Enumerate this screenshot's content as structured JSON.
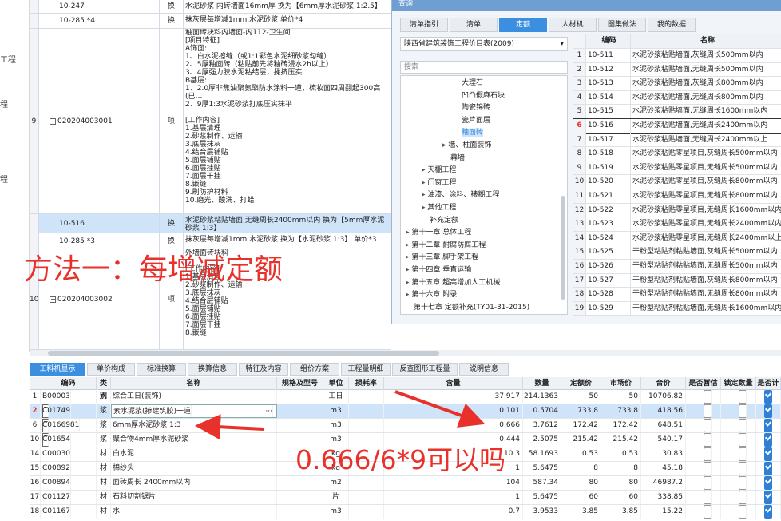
{
  "left_strip": [
    "工程",
    "程",
    "程"
  ],
  "grid_rows": [
    {
      "seq": "",
      "code": "10-247",
      "cat": "换",
      "name": "水泥砂浆 内砖墙面16mm厚  换为【6mm厚水泥砂浆 1:2.5】",
      "indent": true
    },
    {
      "seq": "",
      "code": "10-285 *4",
      "cat": "换",
      "name": "抹灰层每增减1mm,水泥砂浆  单价*4",
      "indent": true
    },
    {
      "seq": "9",
      "code": "020204003001",
      "cat": "项",
      "name": "釉面砖块料内墙面-内112-卫生间\n[项目特征]\nA饰面:\n1、白水泥擦缝（或1:1彩色水泥细砂浆勾缝）\n2、5厚釉面砖（粘贴前先将釉砖浸水2h以上）\n3、4厚强力胶水泥粘结层，揉挤压实\nB基层:\n1、2.0厚非焦油聚氨酯防水涂料一道，梳妆面四周翻起300高(已…\n2、9厚1:3水泥砂浆打底压实抹平\n\n[工作内容]\n1.基层清理\n2.砂浆制作、运输\n3.底层抹灰\n4.结合层铺贴\n5.面层铺贴\n6.面层挂贴\n7.面层干挂\n8.嵌缝\n9.刷防护材料\n10.磨光、酸洗、打蜡",
      "indent": false
    },
    {
      "seq": "",
      "code": "10-516",
      "cat": "换",
      "name": "水泥砂浆粘贴墙面,无缝周长2400mm以内  换为【5mm厚水泥砂浆 1:3】",
      "indent": true
    },
    {
      "seq": "",
      "code": "10-285 *3",
      "cat": "换",
      "name": "抹灰层每增减1mm,水泥砂浆  换为【水泥砂浆 1:3】  单价*3",
      "indent": true
    },
    {
      "seq": "10",
      "code": "020204003002",
      "cat": "项",
      "name": "外墙面砖块料\n\n[工作内容]\n1.基层清理\n2.砂浆制作、运输\n3.底层抹灰\n4.结合层铺贴\n5.面层铺贴\n6.面层挂贴\n7.面层干挂\n8.嵌缝",
      "indent": false
    }
  ],
  "annotation_1": "方法一：每增减定额",
  "annotation_2": "0.666/6*9可以吗",
  "dialog": {
    "title": "查询",
    "tabs": [
      "清单指引",
      "清单",
      "定额",
      "人材机",
      "图集做法",
      "我的数据"
    ],
    "active_tab": "定额",
    "quota_select": "陕西省建筑装饰工程价目表(2009)",
    "search_placeholder": "搜索",
    "tree": [
      {
        "label": "大理石",
        "level": 3
      },
      {
        "label": "凹凸假麻石块",
        "level": 3
      },
      {
        "label": "陶瓷锦砖",
        "level": 3
      },
      {
        "label": "瓷片面层",
        "level": 3
      },
      {
        "label": "釉面砖",
        "level": 3,
        "selected": true
      },
      {
        "label": "墙、柱面装饰",
        "level": 2,
        "arrow": "▸"
      },
      {
        "label": "幕墙",
        "level": 2
      },
      {
        "label": "天棚工程",
        "level": 1,
        "arrow": "▸"
      },
      {
        "label": "门窗工程",
        "level": 1,
        "arrow": "▸"
      },
      {
        "label": "油漆、涂料、裱糊工程",
        "level": 1,
        "arrow": "▸"
      },
      {
        "label": "其他工程",
        "level": 1,
        "arrow": "▸"
      },
      {
        "label": "补充定额",
        "level": 1
      },
      {
        "label": "第十一章 总体工程",
        "level": 0,
        "arrow": "▸"
      },
      {
        "label": "第十二章 耐腐防腐工程",
        "level": 0,
        "arrow": "▸"
      },
      {
        "label": "第十三章 脚手架工程",
        "level": 0,
        "arrow": "▸"
      },
      {
        "label": "第十四章 垂直运输",
        "level": 0,
        "arrow": "▸"
      },
      {
        "label": "第十五章 超高增加人工机械",
        "level": 0,
        "arrow": "▸"
      },
      {
        "label": "第十六章 附录",
        "level": 0,
        "arrow": "▸"
      },
      {
        "label": "第十七章 定额补充(TY01-31-2015)",
        "level": 0
      }
    ],
    "table_head": {
      "code": "编码",
      "name": "名称"
    },
    "table_rows": [
      {
        "n": "1",
        "code": "10-511",
        "name": "水泥砂浆粘贴墙面,灰缝周长500mm以内"
      },
      {
        "n": "2",
        "code": "10-512",
        "name": "水泥砂浆粘贴墙面,无缝周长500mm以内"
      },
      {
        "n": "3",
        "code": "10-513",
        "name": "水泥砂浆粘贴墙面,灰缝周长800mm以内"
      },
      {
        "n": "4",
        "code": "10-514",
        "name": "水泥砂浆粘贴墙面,无缝周长800mm以内"
      },
      {
        "n": "5",
        "code": "10-515",
        "name": "水泥砂浆粘贴墙面,无缝周长1600mm以内"
      },
      {
        "n": "6",
        "code": "10-516",
        "name": "水泥砂浆粘贴墙面,无缝周长2400mm以内",
        "selected": true
      },
      {
        "n": "7",
        "code": "10-517",
        "name": "水泥砂浆粘贴墙面,无缝周长2400mm以上"
      },
      {
        "n": "8",
        "code": "10-518",
        "name": "水泥砂浆粘贴零星项目,灰缝周长500mm以内"
      },
      {
        "n": "9",
        "code": "10-519",
        "name": "水泥砂浆粘贴零星项目,无缝周长500mm以内"
      },
      {
        "n": "10",
        "code": "10-520",
        "name": "水泥砂浆粘贴零星项目,灰缝周长800mm以内"
      },
      {
        "n": "11",
        "code": "10-521",
        "name": "水泥砂浆粘贴零星项目,无缝周长800mm以内"
      },
      {
        "n": "12",
        "code": "10-522",
        "name": "水泥砂浆粘贴零星项目,无缝周长1600mm以内"
      },
      {
        "n": "13",
        "code": "10-523",
        "name": "水泥砂浆粘贴零星项目,无缝周长2400mm以内"
      },
      {
        "n": "14",
        "code": "10-524",
        "name": "水泥砂浆粘贴零星项目,无缝周长2400mm以上"
      },
      {
        "n": "15",
        "code": "10-525",
        "name": "干粉型粘贴剂粘贴墙面,灰缝周长500mm以内"
      },
      {
        "n": "16",
        "code": "10-526",
        "name": "干粉型粘贴剂粘贴墙面,无缝周长500mm以内"
      },
      {
        "n": "17",
        "code": "10-527",
        "name": "干粉型粘贴剂粘贴墙面,灰缝周长800mm以内"
      },
      {
        "n": "18",
        "code": "10-528",
        "name": "干粉型粘贴剂粘贴墙面,无缝周长800mm以内"
      },
      {
        "n": "19",
        "code": "10-529",
        "name": "干粉型粘贴剂粘贴墙面,无缝周长1600mm以内"
      }
    ]
  },
  "bottom_tabs": [
    "工料机显示",
    "单价构成",
    "标准换算",
    "换算信息",
    "特征及内容",
    "组价方案",
    "工程量明细",
    "反查图形工程量",
    "说明信息"
  ],
  "bottom_active": "工料机显示",
  "materials_head": [
    "编码",
    "类别",
    "名称",
    "规格及型号",
    "单位",
    "损耗率",
    "含量",
    "数量",
    "定额价",
    "市场价",
    "合价",
    "是否暂估",
    "锁定数量",
    "是否计"
  ],
  "materials": [
    {
      "n": "1",
      "code": "B00003",
      "cat": "人",
      "name": "综合工日(装饰)",
      "spec": "",
      "unit": "工日",
      "loss": "",
      "content": "37.917",
      "qty": "214.1363",
      "quota": "50",
      "market": "50",
      "total": "10706.82",
      "est": false,
      "lock": false,
      "calc": true,
      "plus": false
    },
    {
      "n": "2",
      "code": "C01749",
      "cat": "浆",
      "name": "素水泥浆(掺建筑胶)一道",
      "spec": "",
      "unit": "m3",
      "loss": "",
      "content": "0.101",
      "qty": "0.5704",
      "quota": "733.8",
      "market": "733.8",
      "total": "418.56",
      "est": false,
      "lock": false,
      "calc": true,
      "plus": true,
      "selected": true
    },
    {
      "n": "6",
      "code": "C0166981",
      "cat": "浆",
      "name": "6mm厚水泥砂浆 1:3",
      "spec": "",
      "unit": "m3",
      "loss": "",
      "content": "0.666",
      "qty": "3.7612",
      "quota": "172.42",
      "market": "172.42",
      "total": "648.51",
      "est": false,
      "lock": false,
      "calc": true,
      "plus": true
    },
    {
      "n": "10",
      "code": "C01654",
      "cat": "浆",
      "name": "聚合物4mm厚水泥砂浆",
      "spec": "",
      "unit": "m3",
      "loss": "",
      "content": "0.444",
      "qty": "2.5075",
      "quota": "215.42",
      "market": "215.42",
      "total": "540.17",
      "est": false,
      "lock": false,
      "calc": true,
      "plus": true
    },
    {
      "n": "14",
      "code": "C00030",
      "cat": "材",
      "name": "白水泥",
      "spec": "",
      "unit": "kg",
      "loss": "",
      "content": "10.3",
      "qty": "58.1693",
      "quota": "0.53",
      "market": "0.53",
      "total": "30.83",
      "est": false,
      "lock": false,
      "calc": true,
      "plus": false
    },
    {
      "n": "15",
      "code": "C00892",
      "cat": "材",
      "name": "棉纱头",
      "spec": "",
      "unit": "kg",
      "loss": "",
      "content": "1",
      "qty": "5.6475",
      "quota": "8",
      "market": "8",
      "total": "45.18",
      "est": false,
      "lock": false,
      "calc": true,
      "plus": false
    },
    {
      "n": "16",
      "code": "C00894",
      "cat": "材",
      "name": "面砖周长 2400mm以内",
      "spec": "",
      "unit": "m2",
      "loss": "",
      "content": "104",
      "qty": "587.34",
      "quota": "80",
      "market": "80",
      "total": "46987.2",
      "est": false,
      "lock": false,
      "calc": true,
      "plus": false
    },
    {
      "n": "17",
      "code": "C01127",
      "cat": "材",
      "name": "石料切割锯片",
      "spec": "",
      "unit": "片",
      "loss": "",
      "content": "1",
      "qty": "5.6475",
      "quota": "60",
      "market": "60",
      "total": "338.85",
      "est": false,
      "lock": false,
      "calc": true,
      "plus": false
    },
    {
      "n": "18",
      "code": "C01167",
      "cat": "材",
      "name": "水",
      "spec": "",
      "unit": "m3",
      "loss": "",
      "content": "0.7",
      "qty": "3.9533",
      "quota": "3.85",
      "market": "3.85",
      "total": "15.22",
      "est": false,
      "lock": false,
      "calc": true,
      "plus": false
    }
  ],
  "colors": {
    "accent": "#3b8fe0",
    "annotation": "#e8312b",
    "selected_row": "#cfe4f8"
  }
}
